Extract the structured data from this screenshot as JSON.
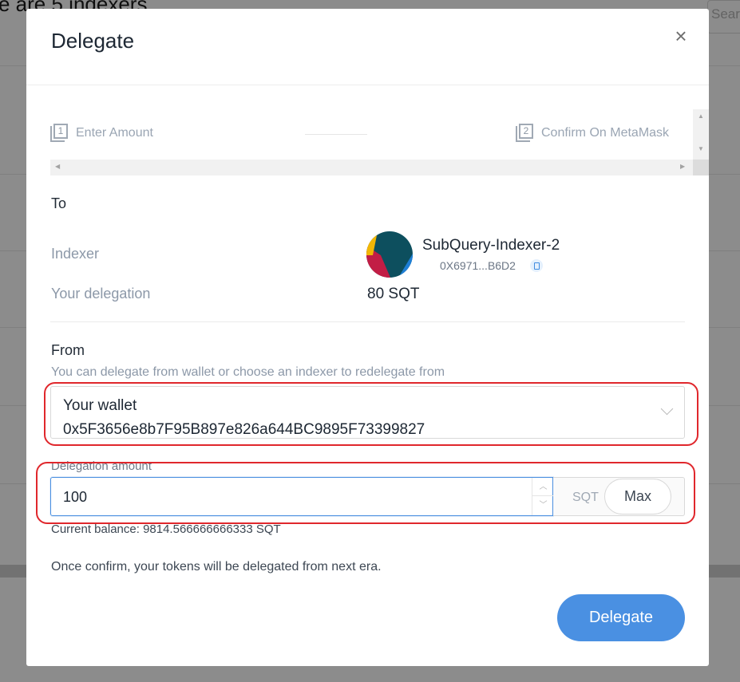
{
  "background": {
    "heading": "e are 5 indexers",
    "search_placeholder": "Search"
  },
  "modal": {
    "title": "Delegate",
    "close_icon": "close-icon",
    "steps": [
      {
        "number": "1",
        "label": "Enter Amount",
        "icon": "step-number-icon"
      },
      {
        "number": "2",
        "label": "Confirm On MetaMask",
        "icon": "step-number-icon"
      }
    ],
    "to": {
      "label": "To",
      "indexer_label": "Indexer",
      "indexer_name": "SubQuery-Indexer-2",
      "indexer_address": "0X6971...B6D2",
      "delegation_label": "Your delegation",
      "delegation_value": "80 SQT"
    },
    "from": {
      "label": "From",
      "hint": "You can delegate from wallet or choose an indexer to redelegate from",
      "selected_title": "Your wallet",
      "selected_address": "0x5F3656e8b7F95B897e826a644BC9895F73399827"
    },
    "amount": {
      "label": "Delegation amount",
      "value": "100",
      "unit": "SQT",
      "max_label": "Max",
      "balance_text": "Current balance: 9814.566666666333 SQT"
    },
    "notice": "Once confirm, your tokens will be delegated from next era.",
    "submit_label": "Delegate"
  },
  "colors": {
    "accent": "#4a90e2",
    "highlight_box": "#e0272c",
    "muted_text": "#8c98a8"
  }
}
